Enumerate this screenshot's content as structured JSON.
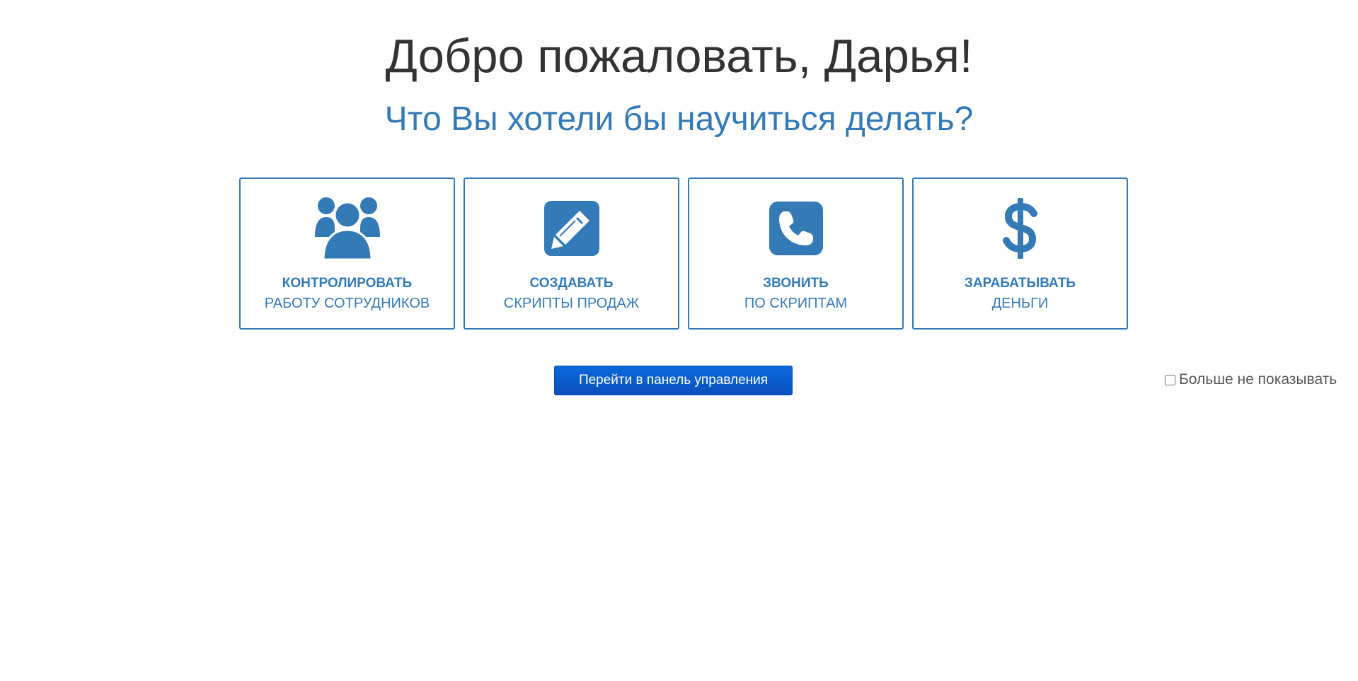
{
  "welcome": {
    "title": "Добро пожаловать, Дарья!",
    "subtitle": "Что Вы хотели бы научиться делать?"
  },
  "cards": [
    {
      "icon": "users-icon",
      "label_main": "КОНТРОЛИРОВАТЬ",
      "label_sub": "РАБОТУ СОТРУДНИКОВ"
    },
    {
      "icon": "edit-pencil-icon",
      "label_main": "СОЗДАВАТЬ",
      "label_sub": "СКРИПТЫ ПРОДАЖ"
    },
    {
      "icon": "phone-icon",
      "label_main": "ЗВОНИТЬ",
      "label_sub": "ПО СКРИПТАМ"
    },
    {
      "icon": "dollar-icon",
      "label_main": "ЗАРАБАТЫВАТЬ",
      "label_sub": "ДЕНЬГИ"
    }
  ],
  "actions": {
    "go_to_dashboard_label": "Перейти в панель управления",
    "dont_show_label": "Больше не показывать",
    "dont_show_checked": false
  },
  "colors": {
    "accent": "#337ab7",
    "title_text": "#333333",
    "button_top": "#0a6ad8",
    "button_bottom": "#0a4fc0"
  }
}
